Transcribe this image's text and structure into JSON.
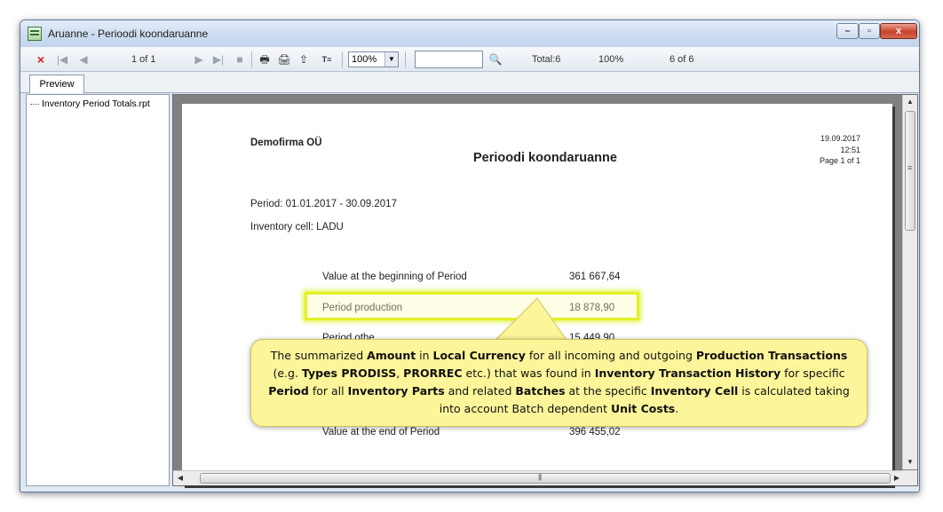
{
  "window": {
    "title": "Aruanne - Perioodi koondaruanne",
    "controls": {
      "minimize": "–",
      "maximize": "▫",
      "close": "x"
    }
  },
  "toolbar": {
    "stop_icon": "×",
    "first_icon": "|◀",
    "prev_icon": "◀",
    "page_indicator": "1 of 1",
    "next_icon": "▶",
    "last_icon": "▶|",
    "stop_square": "■",
    "print_icon": "🖶",
    "print_setup_icon": "🖨",
    "export_icon": "⇪",
    "tree_icon": "T≡",
    "zoom_value": "100%",
    "search_value": "",
    "find_icon": "🔍",
    "total_label": "Total:6",
    "percent_label": "100%",
    "count_label": "6 of 6"
  },
  "tabs": {
    "preview": "Preview"
  },
  "tree": {
    "items": [
      "Inventory Period Totals.rpt"
    ]
  },
  "report": {
    "company": "Demofirma OÜ",
    "title": "Perioodi koondaruanne",
    "date": "19.09.2017",
    "time": "12:51",
    "page": "Page 1 of 1",
    "period": "Period: 01.01.2017 - 30.09.2017",
    "inventory_cell": "Inventory cell: LADU",
    "rows": [
      {
        "label": "Value at the beginning of Period",
        "value": "361 667,64"
      },
      {
        "label": "Period production",
        "value": "18 878,90"
      },
      {
        "label": "Period othe",
        "value": "15 449,90"
      },
      {
        "label": "Value at the end of Period",
        "value": "396 455,02"
      }
    ]
  },
  "callout": {
    "parts": [
      "The summarized ",
      "Amount",
      " in ",
      "Local Currency",
      " for all incoming and outgoing ",
      "Production Transactions",
      " (e.g. ",
      "Types PRODISS",
      ", ",
      "PRORREC",
      " etc.) that was found in ",
      "Inventory Transaction History",
      " for specific ",
      "Period",
      " for all ",
      "Inventory Parts",
      " and related ",
      "Batches",
      " at the specific ",
      "Inventory Cell",
      " is calculated taking into account Batch dependent ",
      "Unit Costs",
      "."
    ]
  },
  "colors": {
    "highlight": "#e4f024",
    "callout_bg": "#fcf59a",
    "title_bar": "#cddcf0"
  }
}
